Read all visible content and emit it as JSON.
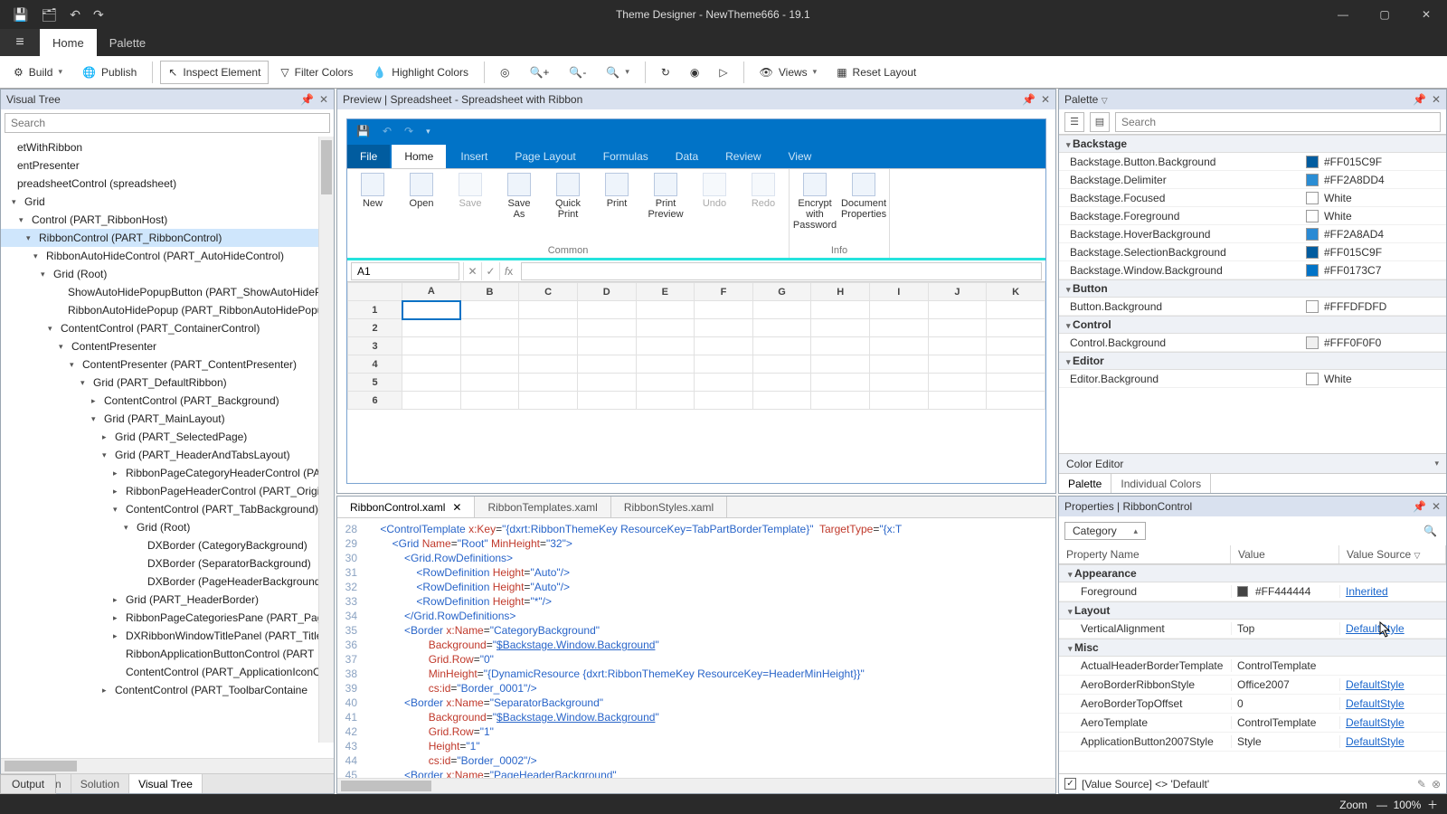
{
  "title": "Theme Designer  -  NewTheme666 - 19.1",
  "menubar": {
    "home": "Home",
    "palette": "Palette"
  },
  "toolbar": {
    "build": "Build",
    "publish": "Publish",
    "inspect": "Inspect Element",
    "filter": "Filter Colors",
    "highlight": "Highlight Colors",
    "views": "Views",
    "reset": "Reset Layout"
  },
  "left": {
    "title": "Visual Tree",
    "search_ph": "Search",
    "tabs": {
      "nav": "Navigation",
      "sol": "Solution",
      "vt": "Visual Tree"
    },
    "rows": [
      {
        "ind": 0,
        "exp": "",
        "t": "etWithRibbon"
      },
      {
        "ind": 0,
        "exp": "",
        "t": ""
      },
      {
        "ind": 0,
        "exp": "",
        "t": "entPresenter"
      },
      {
        "ind": 0,
        "exp": "",
        "t": ""
      },
      {
        "ind": 0,
        "exp": "",
        "t": "preadsheetControl (spreadsheet)"
      },
      {
        "ind": 8,
        "exp": "▾",
        "t": "Grid"
      },
      {
        "ind": 16,
        "exp": "▾",
        "t": "Control (PART_RibbonHost)"
      },
      {
        "ind": 24,
        "exp": "▾",
        "t": "RibbonControl (PART_RibbonControl)",
        "sel": true
      },
      {
        "ind": 32,
        "exp": "▾",
        "t": "RibbonAutoHideControl (PART_AutoHideControl)"
      },
      {
        "ind": 40,
        "exp": "▾",
        "t": "Grid (Root)"
      },
      {
        "ind": 56,
        "exp": "",
        "t": "ShowAutoHidePopupButton (PART_ShowAutoHideP"
      },
      {
        "ind": 56,
        "exp": "",
        "t": "RibbonAutoHidePopup (PART_RibbonAutoHidePopu"
      },
      {
        "ind": 48,
        "exp": "▾",
        "t": "ContentControl (PART_ContainerControl)"
      },
      {
        "ind": 60,
        "exp": "▾",
        "t": "ContentPresenter"
      },
      {
        "ind": 72,
        "exp": "▾",
        "t": "ContentPresenter (PART_ContentPresenter)"
      },
      {
        "ind": 84,
        "exp": "▾",
        "t": "Grid (PART_DefaultRibbon)"
      },
      {
        "ind": 96,
        "exp": "▸",
        "t": "ContentControl (PART_Background)"
      },
      {
        "ind": 96,
        "exp": "▾",
        "t": "Grid (PART_MainLayout)"
      },
      {
        "ind": 108,
        "exp": "▸",
        "t": "Grid (PART_SelectedPage)"
      },
      {
        "ind": 108,
        "exp": "▾",
        "t": "Grid (PART_HeaderAndTabsLayout)"
      },
      {
        "ind": 120,
        "exp": "▸",
        "t": "RibbonPageCategoryHeaderControl (PA"
      },
      {
        "ind": 120,
        "exp": "▸",
        "t": "RibbonPageHeaderControl (PART_Origi"
      },
      {
        "ind": 120,
        "exp": "▾",
        "t": "ContentControl (PART_TabBackground)"
      },
      {
        "ind": 132,
        "exp": "▾",
        "t": "Grid (Root)"
      },
      {
        "ind": 144,
        "exp": "",
        "t": "DXBorder (CategoryBackground)"
      },
      {
        "ind": 144,
        "exp": "",
        "t": "DXBorder (SeparatorBackground)"
      },
      {
        "ind": 144,
        "exp": "",
        "t": "DXBorder (PageHeaderBackground)"
      },
      {
        "ind": 120,
        "exp": "▸",
        "t": "Grid (PART_HeaderBorder)"
      },
      {
        "ind": 120,
        "exp": "▸",
        "t": "RibbonPageCategoriesPane (PART_Page"
      },
      {
        "ind": 120,
        "exp": "▸",
        "t": "DXRibbonWindowTitlePanel (PART_TitleP"
      },
      {
        "ind": 120,
        "exp": "",
        "t": "RibbonApplicationButtonControl (PART"
      },
      {
        "ind": 120,
        "exp": "",
        "t": "ContentControl (PART_ApplicationIconC"
      },
      {
        "ind": 108,
        "exp": "▸",
        "t": "ContentControl (PART_ToolbarContaine"
      }
    ]
  },
  "preview": {
    "title": "Preview | Spreadsheet - Spreadsheet with Ribbon",
    "tabs": [
      "File",
      "Home",
      "Insert",
      "Page Layout",
      "Formulas",
      "Data",
      "Review",
      "View"
    ],
    "groups": {
      "common": {
        "label": "Common",
        "btns": [
          {
            "l": "New"
          },
          {
            "l": "Open"
          },
          {
            "l": "Save",
            "d": true
          },
          {
            "l": "Save\nAs"
          },
          {
            "l": "Quick\nPrint"
          },
          {
            "l": "Print"
          },
          {
            "l": "Print\nPreview"
          },
          {
            "l": "Undo",
            "d": true
          },
          {
            "l": "Redo",
            "d": true
          }
        ]
      },
      "info": {
        "label": "Info",
        "btns": [
          {
            "l": "Encrypt with\nPassword"
          },
          {
            "l": "Document\nProperties"
          }
        ]
      }
    },
    "cellref": "A1",
    "cols": [
      "A",
      "B",
      "C",
      "D",
      "E",
      "F",
      "G",
      "H",
      "I",
      "J",
      "K"
    ],
    "rows": [
      "1",
      "2",
      "3",
      "4",
      "5",
      "6"
    ]
  },
  "code": {
    "tabs": [
      {
        "l": "RibbonControl.xaml",
        "a": true,
        "c": true
      },
      {
        "l": "RibbonTemplates.xaml"
      },
      {
        "l": "RibbonStyles.xaml"
      }
    ],
    "start": 28
  },
  "palette": {
    "title": "Palette",
    "search_ph": "Search",
    "groups": [
      {
        "name": "Backstage",
        "items": [
          {
            "n": "Backstage.Button.Background",
            "c": "#015C9F",
            "v": "#FF015C9F"
          },
          {
            "n": "Backstage.Delimiter",
            "c": "#2A8DD4",
            "v": "#FF2A8DD4"
          },
          {
            "n": "Backstage.Focused",
            "c": "#FFFFFF",
            "v": "White"
          },
          {
            "n": "Backstage.Foreground",
            "c": "#FFFFFF",
            "v": "White"
          },
          {
            "n": "Backstage.HoverBackground",
            "c": "#2A8AD4",
            "v": "#FF2A8AD4"
          },
          {
            "n": "Backstage.SelectionBackground",
            "c": "#015C9F",
            "v": "#FF015C9F"
          },
          {
            "n": "Backstage.Window.Background",
            "c": "#0173C7",
            "v": "#FF0173C7"
          }
        ]
      },
      {
        "name": "Button",
        "items": [
          {
            "n": "Button.Background",
            "c": "#FDFDFD",
            "v": "#FFFDFDFD"
          }
        ]
      },
      {
        "name": "Control",
        "items": [
          {
            "n": "Control.Background",
            "c": "#F0F0F0",
            "v": "#FFF0F0F0"
          }
        ]
      },
      {
        "name": "Editor",
        "items": [
          {
            "n": "Editor.Background",
            "c": "#FFFFFF",
            "v": "White"
          }
        ]
      }
    ],
    "footer": "Color Editor",
    "tabs": {
      "p": "Palette",
      "ic": "Individual Colors"
    }
  },
  "props": {
    "title": "Properties | RibbonControl",
    "category": "Category",
    "cols": {
      "c1": "Property Name",
      "c2": "Value",
      "c3": "Value Source"
    },
    "groups": [
      {
        "name": "Appearance",
        "rows": [
          {
            "n": "Foreground",
            "v": "#FF444444",
            "sw": "#444444",
            "src": "Inherited"
          }
        ]
      },
      {
        "name": "Layout",
        "rows": [
          {
            "n": "VerticalAlignment",
            "v": "Top",
            "src": "DefaultStyle"
          }
        ]
      },
      {
        "name": "Misc",
        "rows": [
          {
            "n": "ActualHeaderBorderTemplate",
            "v": "ControlTemplate",
            "src": ""
          },
          {
            "n": "AeroBorderRibbonStyle",
            "v": "Office2007",
            "src": "DefaultStyle"
          },
          {
            "n": "AeroBorderTopOffset",
            "v": "0",
            "src": "DefaultStyle"
          },
          {
            "n": "AeroTemplate",
            "v": "ControlTemplate",
            "src": "DefaultStyle"
          },
          {
            "n": "ApplicationButton2007Style",
            "v": "Style",
            "src": "DefaultStyle"
          }
        ]
      }
    ],
    "filter": "[Value Source] <> 'Default'"
  },
  "output": "Output",
  "status": {
    "zoom_l": "Zoom",
    "zoom_v": "100%"
  }
}
